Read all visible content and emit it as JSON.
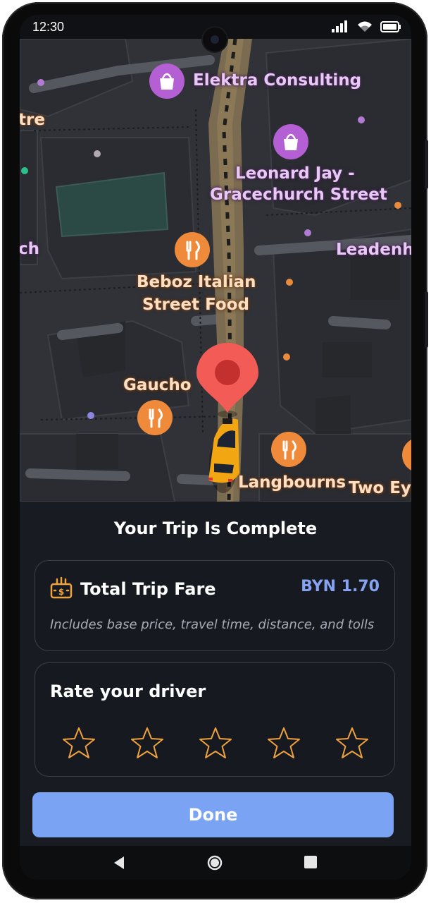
{
  "status_bar": {
    "time": "12:30"
  },
  "map": {
    "places": [
      {
        "label": "Elektra Consulting",
        "kind": "shopping"
      },
      {
        "label": "Leonard Jay -",
        "label2": "Gracechurch Street",
        "kind": "shopping"
      },
      {
        "label": "Leadenha",
        "kind": "place"
      },
      {
        "label": "Beboz Italian",
        "label2": "Street Food",
        "kind": "restaurant"
      },
      {
        "label": "Gaucho",
        "kind": "restaurant"
      },
      {
        "label": "Langbourns",
        "kind": "restaurant"
      },
      {
        "label": "Two Eye",
        "kind": "restaurant"
      },
      {
        "label": "tre",
        "kind": "place"
      },
      {
        "label": "ch",
        "kind": "place"
      }
    ]
  },
  "trip_summary": {
    "title": "Your Trip Is Complete",
    "fare": {
      "icon": "cash-icon",
      "title": "Total Trip Fare",
      "amount": "BYN 1.70",
      "note": "Includes base price, travel time, distance, and tolls"
    },
    "rating": {
      "title": "Rate your driver",
      "max_stars": 5,
      "selected": 0
    },
    "done_button": "Done"
  },
  "colors": {
    "accent": "#7aa3f3",
    "fare_amount": "#86a4f2",
    "star": "#f0a23c",
    "sheet_bg": "#181b22"
  }
}
